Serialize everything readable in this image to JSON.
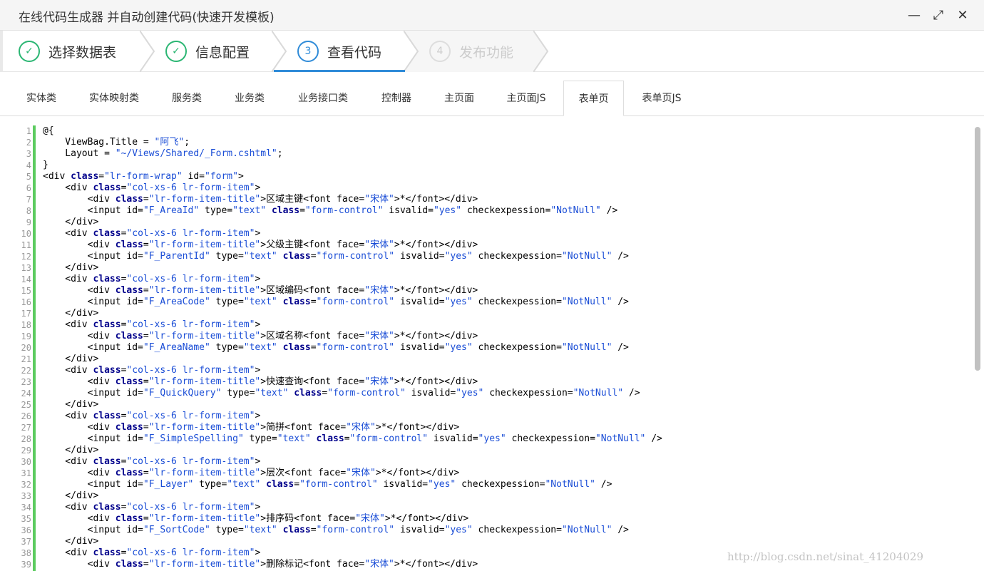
{
  "window": {
    "title": "在线代码生成器 并自动创建代码(快速开发模板)",
    "controls": [
      {
        "name": "minimize-icon",
        "glyph": "—"
      },
      {
        "name": "maximize-icon",
        "glyph": "⤢"
      },
      {
        "name": "close-icon",
        "glyph": "✕"
      }
    ]
  },
  "wizard": {
    "steps": [
      {
        "label": "选择数据表",
        "status": "done",
        "marker": "✓"
      },
      {
        "label": "信息配置",
        "status": "done",
        "marker": "✓"
      },
      {
        "label": "查看代码",
        "status": "active",
        "marker": "3"
      },
      {
        "label": "发布功能",
        "status": "pending",
        "marker": "4"
      }
    ]
  },
  "tabs": [
    {
      "label": "实体类"
    },
    {
      "label": "实体映射类"
    },
    {
      "label": "服务类"
    },
    {
      "label": "业务类"
    },
    {
      "label": "业务接口类"
    },
    {
      "label": "控制器"
    },
    {
      "label": "主页面"
    },
    {
      "label": "主页面JS"
    },
    {
      "label": "表单页",
      "active": true
    },
    {
      "label": "表单页JS"
    }
  ],
  "code": {
    "lines": [
      [
        [
          "t",
          "@{"
        ]
      ],
      [
        [
          "t",
          "    ViewBag.Title = "
        ],
        [
          "s",
          "\"阿飞\""
        ],
        [
          "t",
          ";"
        ]
      ],
      [
        [
          "t",
          "    Layout = "
        ],
        [
          "s",
          "\"~/Views/Shared/_Form.cshtml\""
        ],
        [
          "t",
          ";"
        ]
      ],
      [
        [
          "t",
          "}"
        ]
      ],
      [
        [
          "t",
          "<div "
        ],
        [
          "k",
          "class"
        ],
        [
          "t",
          "="
        ],
        [
          "s",
          "\"lr-form-wrap\""
        ],
        [
          "t",
          " id="
        ],
        [
          "s",
          "\"form\""
        ],
        [
          "t",
          ">"
        ]
      ],
      [
        [
          "t",
          "    <div "
        ],
        [
          "k",
          "class"
        ],
        [
          "t",
          "="
        ],
        [
          "s",
          "\"col-xs-6 lr-form-item\""
        ],
        [
          "t",
          ">"
        ]
      ],
      [
        [
          "t",
          "        <div "
        ],
        [
          "k",
          "class"
        ],
        [
          "t",
          "="
        ],
        [
          "s",
          "\"lr-form-item-title\""
        ],
        [
          "t",
          ">区域主键<font face="
        ],
        [
          "s",
          "\"宋体\""
        ],
        [
          "t",
          ">*</font></div>"
        ]
      ],
      [
        [
          "t",
          "        <input id="
        ],
        [
          "s",
          "\"F_AreaId\""
        ],
        [
          "t",
          " type="
        ],
        [
          "s",
          "\"text\""
        ],
        [
          "t",
          " "
        ],
        [
          "k",
          "class"
        ],
        [
          "t",
          "="
        ],
        [
          "s",
          "\"form-control\""
        ],
        [
          "t",
          " isvalid="
        ],
        [
          "s",
          "\"yes\""
        ],
        [
          "t",
          " checkexpession="
        ],
        [
          "s",
          "\"NotNull\""
        ],
        [
          "t",
          " />"
        ]
      ],
      [
        [
          "t",
          "    </div>"
        ]
      ],
      [
        [
          "t",
          "    <div "
        ],
        [
          "k",
          "class"
        ],
        [
          "t",
          "="
        ],
        [
          "s",
          "\"col-xs-6 lr-form-item\""
        ],
        [
          "t",
          ">"
        ]
      ],
      [
        [
          "t",
          "        <div "
        ],
        [
          "k",
          "class"
        ],
        [
          "t",
          "="
        ],
        [
          "s",
          "\"lr-form-item-title\""
        ],
        [
          "t",
          ">父级主键<font face="
        ],
        [
          "s",
          "\"宋体\""
        ],
        [
          "t",
          ">*</font></div>"
        ]
      ],
      [
        [
          "t",
          "        <input id="
        ],
        [
          "s",
          "\"F_ParentId\""
        ],
        [
          "t",
          " type="
        ],
        [
          "s",
          "\"text\""
        ],
        [
          "t",
          " "
        ],
        [
          "k",
          "class"
        ],
        [
          "t",
          "="
        ],
        [
          "s",
          "\"form-control\""
        ],
        [
          "t",
          " isvalid="
        ],
        [
          "s",
          "\"yes\""
        ],
        [
          "t",
          " checkexpession="
        ],
        [
          "s",
          "\"NotNull\""
        ],
        [
          "t",
          " />"
        ]
      ],
      [
        [
          "t",
          "    </div>"
        ]
      ],
      [
        [
          "t",
          "    <div "
        ],
        [
          "k",
          "class"
        ],
        [
          "t",
          "="
        ],
        [
          "s",
          "\"col-xs-6 lr-form-item\""
        ],
        [
          "t",
          ">"
        ]
      ],
      [
        [
          "t",
          "        <div "
        ],
        [
          "k",
          "class"
        ],
        [
          "t",
          "="
        ],
        [
          "s",
          "\"lr-form-item-title\""
        ],
        [
          "t",
          ">区域编码<font face="
        ],
        [
          "s",
          "\"宋体\""
        ],
        [
          "t",
          ">*</font></div>"
        ]
      ],
      [
        [
          "t",
          "        <input id="
        ],
        [
          "s",
          "\"F_AreaCode\""
        ],
        [
          "t",
          " type="
        ],
        [
          "s",
          "\"text\""
        ],
        [
          "t",
          " "
        ],
        [
          "k",
          "class"
        ],
        [
          "t",
          "="
        ],
        [
          "s",
          "\"form-control\""
        ],
        [
          "t",
          " isvalid="
        ],
        [
          "s",
          "\"yes\""
        ],
        [
          "t",
          " checkexpession="
        ],
        [
          "s",
          "\"NotNull\""
        ],
        [
          "t",
          " />"
        ]
      ],
      [
        [
          "t",
          "    </div>"
        ]
      ],
      [
        [
          "t",
          "    <div "
        ],
        [
          "k",
          "class"
        ],
        [
          "t",
          "="
        ],
        [
          "s",
          "\"col-xs-6 lr-form-item\""
        ],
        [
          "t",
          ">"
        ]
      ],
      [
        [
          "t",
          "        <div "
        ],
        [
          "k",
          "class"
        ],
        [
          "t",
          "="
        ],
        [
          "s",
          "\"lr-form-item-title\""
        ],
        [
          "t",
          ">区域名称<font face="
        ],
        [
          "s",
          "\"宋体\""
        ],
        [
          "t",
          ">*</font></div>"
        ]
      ],
      [
        [
          "t",
          "        <input id="
        ],
        [
          "s",
          "\"F_AreaName\""
        ],
        [
          "t",
          " type="
        ],
        [
          "s",
          "\"text\""
        ],
        [
          "t",
          " "
        ],
        [
          "k",
          "class"
        ],
        [
          "t",
          "="
        ],
        [
          "s",
          "\"form-control\""
        ],
        [
          "t",
          " isvalid="
        ],
        [
          "s",
          "\"yes\""
        ],
        [
          "t",
          " checkexpession="
        ],
        [
          "s",
          "\"NotNull\""
        ],
        [
          "t",
          " />"
        ]
      ],
      [
        [
          "t",
          "    </div>"
        ]
      ],
      [
        [
          "t",
          "    <div "
        ],
        [
          "k",
          "class"
        ],
        [
          "t",
          "="
        ],
        [
          "s",
          "\"col-xs-6 lr-form-item\""
        ],
        [
          "t",
          ">"
        ]
      ],
      [
        [
          "t",
          "        <div "
        ],
        [
          "k",
          "class"
        ],
        [
          "t",
          "="
        ],
        [
          "s",
          "\"lr-form-item-title\""
        ],
        [
          "t",
          ">快速查询<font face="
        ],
        [
          "s",
          "\"宋体\""
        ],
        [
          "t",
          ">*</font></div>"
        ]
      ],
      [
        [
          "t",
          "        <input id="
        ],
        [
          "s",
          "\"F_QuickQuery\""
        ],
        [
          "t",
          " type="
        ],
        [
          "s",
          "\"text\""
        ],
        [
          "t",
          " "
        ],
        [
          "k",
          "class"
        ],
        [
          "t",
          "="
        ],
        [
          "s",
          "\"form-control\""
        ],
        [
          "t",
          " isvalid="
        ],
        [
          "s",
          "\"yes\""
        ],
        [
          "t",
          " checkexpession="
        ],
        [
          "s",
          "\"NotNull\""
        ],
        [
          "t",
          " />"
        ]
      ],
      [
        [
          "t",
          "    </div>"
        ]
      ],
      [
        [
          "t",
          "    <div "
        ],
        [
          "k",
          "class"
        ],
        [
          "t",
          "="
        ],
        [
          "s",
          "\"col-xs-6 lr-form-item\""
        ],
        [
          "t",
          ">"
        ]
      ],
      [
        [
          "t",
          "        <div "
        ],
        [
          "k",
          "class"
        ],
        [
          "t",
          "="
        ],
        [
          "s",
          "\"lr-form-item-title\""
        ],
        [
          "t",
          ">简拼<font face="
        ],
        [
          "s",
          "\"宋体\""
        ],
        [
          "t",
          ">*</font></div>"
        ]
      ],
      [
        [
          "t",
          "        <input id="
        ],
        [
          "s",
          "\"F_SimpleSpelling\""
        ],
        [
          "t",
          " type="
        ],
        [
          "s",
          "\"text\""
        ],
        [
          "t",
          " "
        ],
        [
          "k",
          "class"
        ],
        [
          "t",
          "="
        ],
        [
          "s",
          "\"form-control\""
        ],
        [
          "t",
          " isvalid="
        ],
        [
          "s",
          "\"yes\""
        ],
        [
          "t",
          " checkexpession="
        ],
        [
          "s",
          "\"NotNull\""
        ],
        [
          "t",
          " />"
        ]
      ],
      [
        [
          "t",
          "    </div>"
        ]
      ],
      [
        [
          "t",
          "    <div "
        ],
        [
          "k",
          "class"
        ],
        [
          "t",
          "="
        ],
        [
          "s",
          "\"col-xs-6 lr-form-item\""
        ],
        [
          "t",
          ">"
        ]
      ],
      [
        [
          "t",
          "        <div "
        ],
        [
          "k",
          "class"
        ],
        [
          "t",
          "="
        ],
        [
          "s",
          "\"lr-form-item-title\""
        ],
        [
          "t",
          ">层次<font face="
        ],
        [
          "s",
          "\"宋体\""
        ],
        [
          "t",
          ">*</font></div>"
        ]
      ],
      [
        [
          "t",
          "        <input id="
        ],
        [
          "s",
          "\"F_Layer\""
        ],
        [
          "t",
          " type="
        ],
        [
          "s",
          "\"text\""
        ],
        [
          "t",
          " "
        ],
        [
          "k",
          "class"
        ],
        [
          "t",
          "="
        ],
        [
          "s",
          "\"form-control\""
        ],
        [
          "t",
          " isvalid="
        ],
        [
          "s",
          "\"yes\""
        ],
        [
          "t",
          " checkexpession="
        ],
        [
          "s",
          "\"NotNull\""
        ],
        [
          "t",
          " />"
        ]
      ],
      [
        [
          "t",
          "    </div>"
        ]
      ],
      [
        [
          "t",
          "    <div "
        ],
        [
          "k",
          "class"
        ],
        [
          "t",
          "="
        ],
        [
          "s",
          "\"col-xs-6 lr-form-item\""
        ],
        [
          "t",
          ">"
        ]
      ],
      [
        [
          "t",
          "        <div "
        ],
        [
          "k",
          "class"
        ],
        [
          "t",
          "="
        ],
        [
          "s",
          "\"lr-form-item-title\""
        ],
        [
          "t",
          ">排序码<font face="
        ],
        [
          "s",
          "\"宋体\""
        ],
        [
          "t",
          ">*</font></div>"
        ]
      ],
      [
        [
          "t",
          "        <input id="
        ],
        [
          "s",
          "\"F_SortCode\""
        ],
        [
          "t",
          " type="
        ],
        [
          "s",
          "\"text\""
        ],
        [
          "t",
          " "
        ],
        [
          "k",
          "class"
        ],
        [
          "t",
          "="
        ],
        [
          "s",
          "\"form-control\""
        ],
        [
          "t",
          " isvalid="
        ],
        [
          "s",
          "\"yes\""
        ],
        [
          "t",
          " checkexpession="
        ],
        [
          "s",
          "\"NotNull\""
        ],
        [
          "t",
          " />"
        ]
      ],
      [
        [
          "t",
          "    </div>"
        ]
      ],
      [
        [
          "t",
          "    <div "
        ],
        [
          "k",
          "class"
        ],
        [
          "t",
          "="
        ],
        [
          "s",
          "\"col-xs-6 lr-form-item\""
        ],
        [
          "t",
          ">"
        ]
      ],
      [
        [
          "t",
          "        <div "
        ],
        [
          "k",
          "class"
        ],
        [
          "t",
          "="
        ],
        [
          "s",
          "\"lr-form-item-title\""
        ],
        [
          "t",
          ">删除标记<font face="
        ],
        [
          "s",
          "\"宋体\""
        ],
        [
          "t",
          ">*</font></div>"
        ]
      ]
    ]
  },
  "watermark": "http://blog.csdn.net/sinat_41204029",
  "colors": {
    "done": "#2bb673",
    "active": "#2f8bd8",
    "gutter_bar": "#5ccb5f",
    "keyword": "#00008b",
    "string": "#1a4dd6"
  }
}
